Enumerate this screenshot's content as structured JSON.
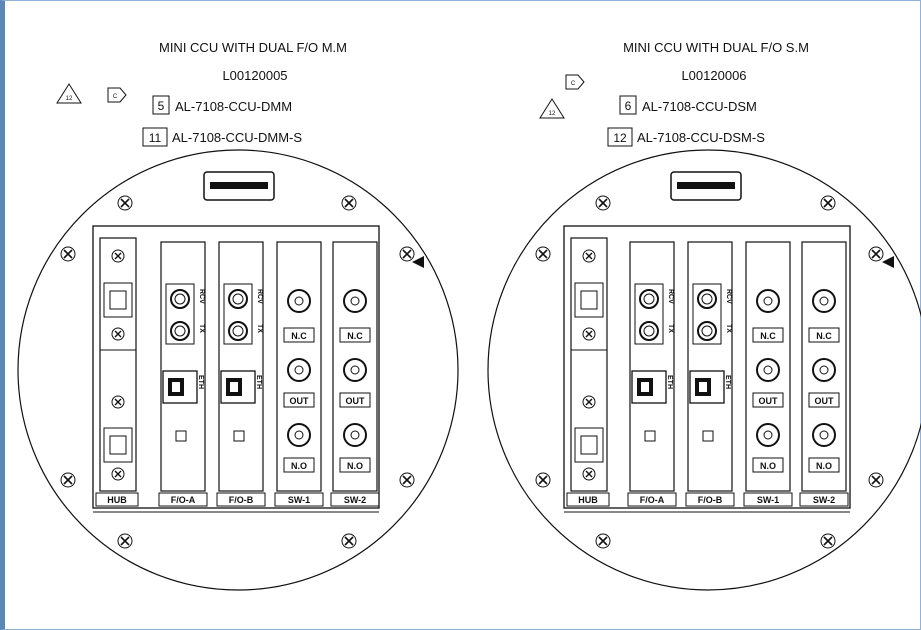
{
  "left": {
    "title": "MINI CCU WITH DUAL F/O M.M",
    "drawing_no": "L00120005",
    "callouts": [
      {
        "num": "5",
        "part": "AL-7108-CCU-DMM"
      },
      {
        "num": "11",
        "part": "AL-7108-CCU-DMM-S"
      }
    ],
    "cards": [
      "HUB",
      "F/O-A",
      "F/O-B",
      "SW-1",
      "SW-2"
    ]
  },
  "right": {
    "title": "MINI CCU WITH DUAL F/O S.M",
    "drawing_no": "L00120006",
    "callouts": [
      {
        "num": "6",
        "part": "AL-7108-CCU-DSM"
      },
      {
        "num": "12",
        "part": "AL-7108-CCU-DSM-S"
      }
    ],
    "cards": [
      "HUB",
      "F/O-A",
      "F/O-B",
      "SW-1",
      "SW-2"
    ]
  },
  "revision": {
    "flag_letter": "C",
    "triangle_number": "12"
  },
  "port_labels": {
    "rcv": "RCV",
    "tx": "TX",
    "eth": "ETH",
    "nc": "N.C",
    "out": "OUT",
    "no": "N.O"
  }
}
